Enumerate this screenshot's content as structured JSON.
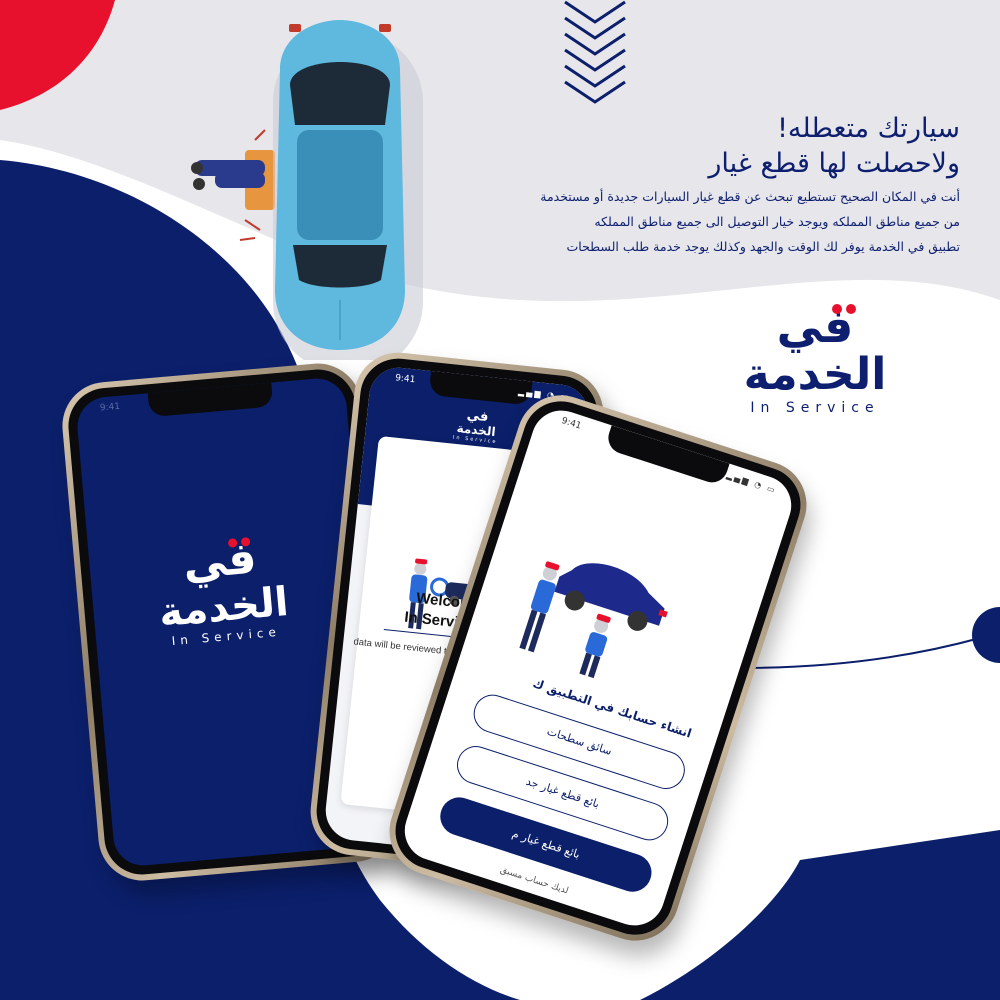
{
  "colors": {
    "navy": "#0b1f6b",
    "red": "#e8112d",
    "light_gray": "#e6e6eb",
    "car_blue": "#5fb8dd"
  },
  "headline": {
    "line1": "سيارتك  متعطله!",
    "line2": "ولاحصلت لها قطع غيار",
    "body_line1": "أنت في المكان الصحيح تستطيع تبحث عن قطع غيار السيارات جديدة أو مستخدمة",
    "body_line2": "من جميع مناطق المملكه ويوجد خيار التوصيل الى جميع مناطق المملكه",
    "body_line3": "تطبيق في الخدمة يوفر لك الوقت والجهد وكذلك يوجد خدمة طلب السطحات"
  },
  "brand": {
    "arabic_line1": "في",
    "arabic_line2": "الخدمة",
    "english": "In Service"
  },
  "phone1": {
    "time": "9:41",
    "logo_arabic_line1": "في",
    "logo_arabic_line2": "الخدمة",
    "logo_english": "In Service"
  },
  "phone2": {
    "time": "9:41",
    "header_logo_line1": "في",
    "header_logo_line2": "الخدمة",
    "header_logo_english": "In Service",
    "title_line1": "Welcome to",
    "title_line2": "In Service App",
    "subtitle": "data will be reviewed to start receiving requests"
  },
  "phone3": {
    "time": "9:41",
    "heading": "انشاء حسابك في التطبيق ك",
    "button_tow_driver": "سائق سطحات",
    "button_parts_seller": "بائع قطع غيار جد",
    "button_parts_seller_filled": "بائع قطع غيار م",
    "footer_text": "لديك حساب مسبق"
  },
  "icons": {
    "wifi": "wifi-icon",
    "battery": "battery-icon",
    "signal": "signal-icon"
  }
}
